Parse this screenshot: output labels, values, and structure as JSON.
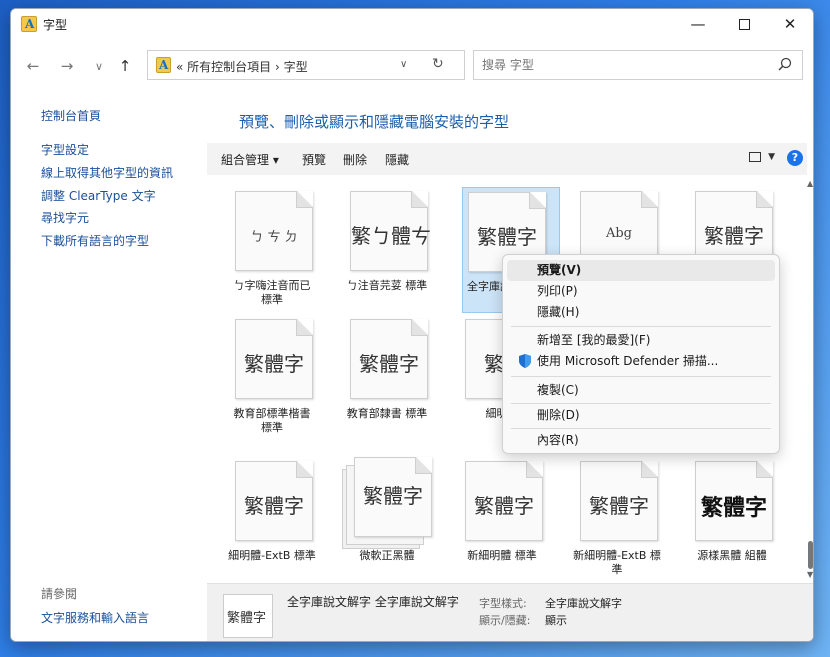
{
  "window": {
    "title": "字型"
  },
  "address": {
    "path": "«  所有控制台項目  ›  字型",
    "search_placeholder": "搜尋 字型"
  },
  "sidebar": {
    "links": [
      "控制台首頁",
      "字型設定",
      "線上取得其他字型的資訊",
      "調整 ClearType 文字",
      "尋找字元",
      "下載所有語言的字型"
    ],
    "see_also_title": "請參閱",
    "see_also_links": [
      "文字服務和輸入語言"
    ]
  },
  "heading": "預覽、刪除或顯示和隱藏電腦安裝的字型",
  "toolbar": {
    "organize": "組合管理 ▾",
    "preview": "預覽",
    "delete": "刪除",
    "hide": "隱藏"
  },
  "fonts": [
    {
      "sample": "ㄅ ㄘ ㄉ",
      "label": "ㄅ字嗨注音而已\n標準"
    },
    {
      "sample": "繁ㄅ體ㄘ",
      "label": "ㄅ注音芫荽 標準"
    },
    {
      "sample": "繁體字",
      "label": "全字庫說\n全字庫說"
    },
    {
      "sample": "Abg",
      "label": ""
    },
    {
      "sample": "繁體字",
      "label": ""
    },
    {
      "sample": "繁體字",
      "label": "教育部標準楷書\n標準"
    },
    {
      "sample": "繁體字",
      "label": "教育部隸書 標準"
    },
    {
      "sample": "繁體",
      "label": "細明體"
    },
    {
      "sample": "繁體字",
      "label": "細明體-ExtB 標準"
    },
    {
      "sample": "繁體字",
      "label": "微軟正黑體"
    },
    {
      "sample": "繁體字",
      "label": "新細明體 標準"
    },
    {
      "sample": "繁體字",
      "label": "新細明體-ExtB 標\n準"
    },
    {
      "sample": "繁體字",
      "label": "源樣黑體 組體"
    }
  ],
  "context_menu": {
    "items": [
      "預覽(V)",
      "列印(P)",
      "隱藏(H)",
      "新增至 [我的最愛](F)",
      "使用 Microsoft Defender 掃描...",
      "複製(C)",
      "刪除(D)",
      "內容(R)"
    ]
  },
  "details": {
    "thumb": "繁體字",
    "name": "全字庫說文解字 全字庫說文解字",
    "style_key": "字型樣式:",
    "style_val": "全字庫說文解字",
    "show_key": "顯示/隱藏:",
    "show_val": "顯示"
  }
}
